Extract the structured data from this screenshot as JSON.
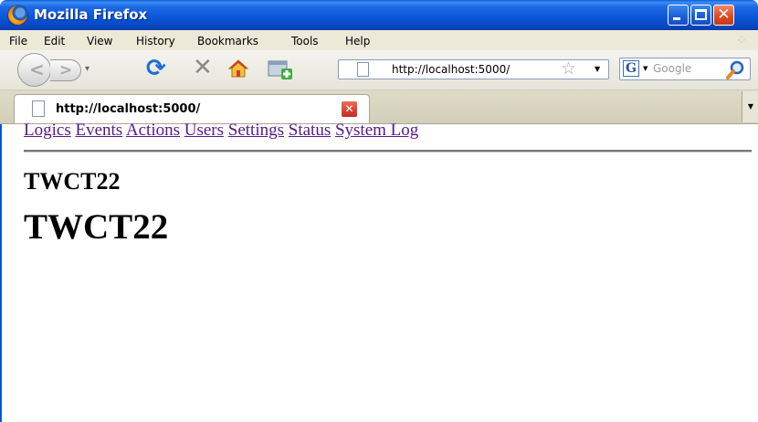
{
  "window": {
    "title": "Mozilla Firefox"
  },
  "menubar": {
    "items": [
      "File",
      "Edit",
      "View",
      "History",
      "Bookmarks",
      "Tools",
      "Help"
    ]
  },
  "toolbar": {
    "url": "http://localhost:5000/",
    "search_placeholder": "Google",
    "search_engine_icon": "G"
  },
  "tabs": [
    {
      "title": "http://localhost:5000/"
    }
  ],
  "page": {
    "nav_links": [
      "Logics",
      "Events",
      "Actions",
      "Users",
      "Settings",
      "Status",
      "System Log"
    ],
    "heading_small": "TWCT22",
    "heading_large": "TWCT22"
  },
  "icons": {
    "back": "left-arrow",
    "forward": "right-arrow",
    "reload": "reload",
    "stop": "stop",
    "home": "home",
    "bookmark_star": "star",
    "search": "magnifier",
    "close_tab": "close"
  }
}
